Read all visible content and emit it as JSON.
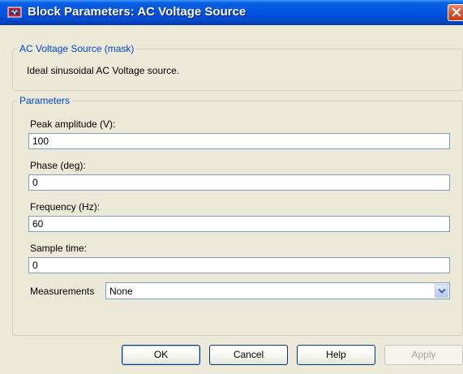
{
  "window": {
    "title": "Block Parameters: AC Voltage Source"
  },
  "mask_group": {
    "legend": "AC Voltage Source (mask)",
    "description": "Ideal sinusoidal AC Voltage source."
  },
  "parameters_group": {
    "legend": "Parameters",
    "fields": [
      {
        "label": "Peak amplitude (V):",
        "value": "100"
      },
      {
        "label": "Phase (deg):",
        "value": "0"
      },
      {
        "label": "Frequency (Hz):",
        "value": "60"
      },
      {
        "label": "Sample time:",
        "value": "0"
      }
    ],
    "measurements": {
      "label": "Measurements",
      "selected": "None"
    }
  },
  "buttons": {
    "ok": "OK",
    "cancel": "Cancel",
    "help": "Help",
    "apply": "Apply"
  },
  "icons": {
    "title": "simulink-block-icon",
    "close": "close-icon",
    "dropdown": "chevron-down-icon"
  },
  "colors": {
    "titlebar": "#0054e3",
    "close_button": "#d8562f",
    "group_legend": "#0046d5",
    "dialog_background": "#ece9d8"
  }
}
